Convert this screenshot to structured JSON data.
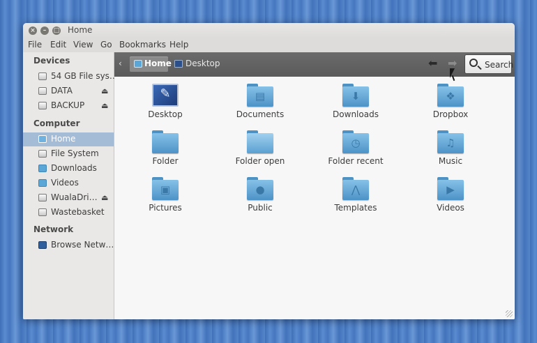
{
  "window": {
    "title": "Home"
  },
  "menubar": [
    "File",
    "Edit",
    "View",
    "Go",
    "Bookmarks",
    "Help"
  ],
  "sidebar": {
    "sections": [
      {
        "heading": "Devices",
        "items": [
          {
            "label": "54 GB File sys…",
            "icon": "drive-icon",
            "eject": false
          },
          {
            "label": "DATA",
            "icon": "drive-icon",
            "eject": true
          },
          {
            "label": "BACKUP",
            "icon": "drive-icon",
            "eject": true
          }
        ]
      },
      {
        "heading": "Computer",
        "items": [
          {
            "label": "Home",
            "icon": "home-folder-icon",
            "selected": true
          },
          {
            "label": "File System",
            "icon": "drive-icon"
          },
          {
            "label": "Downloads",
            "icon": "downloads-folder-icon"
          },
          {
            "label": "Videos",
            "icon": "videos-folder-icon"
          },
          {
            "label": "WualaDri…",
            "icon": "drive-icon",
            "eject": true
          },
          {
            "label": "Wastebasket",
            "icon": "trash-icon"
          }
        ]
      },
      {
        "heading": "Network",
        "items": [
          {
            "label": "Browse Netw…",
            "icon": "network-icon"
          }
        ]
      }
    ]
  },
  "toolbar": {
    "back_chevron": "‹",
    "breadcrumbs": [
      "Home",
      "Desktop"
    ],
    "search_label": "Search"
  },
  "files": [
    {
      "name": "Desktop",
      "icon": "desktop-icon"
    },
    {
      "name": "Documents",
      "icon": "documents-folder-icon"
    },
    {
      "name": "Downloads",
      "icon": "downloads-folder-icon"
    },
    {
      "name": "Dropbox",
      "icon": "dropbox-folder-icon"
    },
    {
      "name": "Folder",
      "icon": "folder-icon"
    },
    {
      "name": "Folder open",
      "icon": "folder-open-icon"
    },
    {
      "name": "Folder recent",
      "icon": "folder-recent-icon"
    },
    {
      "name": "Music",
      "icon": "music-folder-icon"
    },
    {
      "name": "Pictures",
      "icon": "pictures-folder-icon"
    },
    {
      "name": "Public",
      "icon": "public-folder-icon"
    },
    {
      "name": "Templates",
      "icon": "templates-folder-icon"
    },
    {
      "name": "Videos",
      "icon": "videos-folder-icon"
    }
  ],
  "colors": {
    "folder": "#5aa6d6",
    "selection": "#a5bcd6",
    "toolbar": "#636363",
    "desktop_bg": "#4a7cc4"
  }
}
